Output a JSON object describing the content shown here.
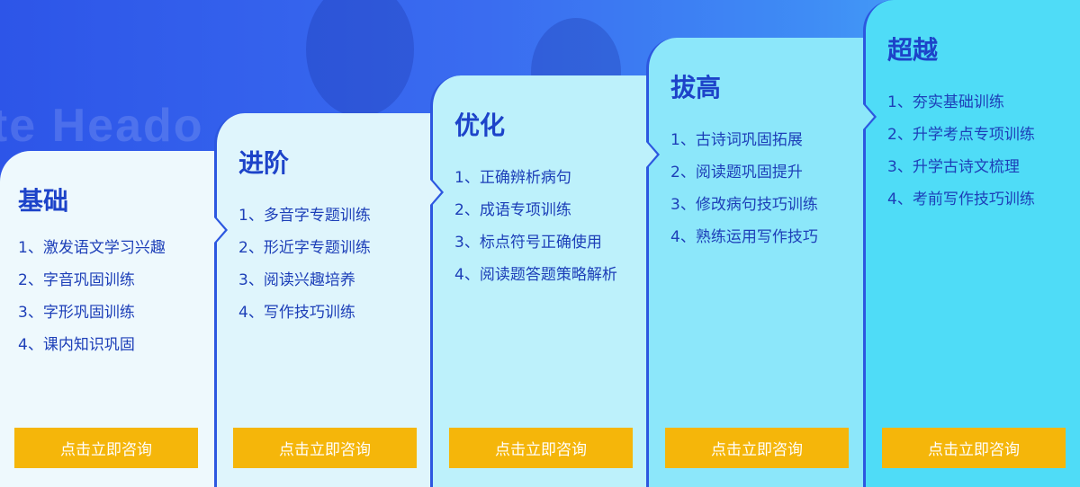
{
  "background": {
    "watermark_text": "ate Heado"
  },
  "colors": {
    "accent_blue": "#1d43c9",
    "button_yellow": "#f5b60a",
    "button_text": "#ffffff"
  },
  "stages": [
    {
      "title": "基础",
      "items": [
        "1、激发语文学习兴趣",
        "2、字音巩固训练",
        "3、字形巩固训练",
        "4、课内知识巩固"
      ],
      "cta_label": "点击立即咨询"
    },
    {
      "title": "进阶",
      "items": [
        "1、多音字专题训练",
        "2、形近字专题训练",
        "3、阅读兴趣培养",
        "4、写作技巧训练"
      ],
      "cta_label": "点击立即咨询"
    },
    {
      "title": "优化",
      "items": [
        "1、正确辨析病句",
        "2、成语专项训练",
        "3、标点符号正确使用",
        "4、阅读题答题策略解析"
      ],
      "cta_label": "点击立即咨询"
    },
    {
      "title": "拔高",
      "items": [
        "1、古诗词巩固拓展",
        "2、阅读题巩固提升",
        "3、修改病句技巧训练",
        "4、熟练运用写作技巧"
      ],
      "cta_label": "点击立即咨询"
    },
    {
      "title": "超越",
      "items": [
        "1、夯实基础训练",
        "2、升学考点专项训练",
        "3、升学古诗文梳理",
        "4、考前写作技巧训练"
      ],
      "cta_label": "点击立即咨询"
    }
  ]
}
